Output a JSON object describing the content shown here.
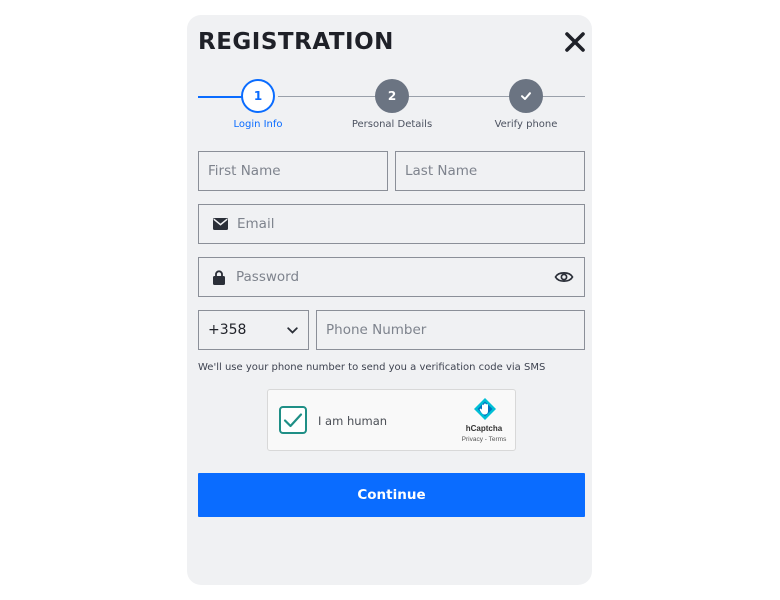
{
  "modal": {
    "title": "REGISTRATION",
    "close_icon": "close-icon"
  },
  "steps": [
    {
      "number": "1",
      "label": "Login Info",
      "state": "active"
    },
    {
      "number": "2",
      "label": "Personal Details",
      "state": "pending"
    },
    {
      "icon": "check-icon",
      "label": "Verify phone",
      "state": "pending"
    }
  ],
  "form": {
    "first_name": {
      "placeholder": "First Name",
      "value": ""
    },
    "last_name": {
      "placeholder": "Last Name",
      "value": ""
    },
    "email": {
      "placeholder": "Email",
      "value": "",
      "icon": "envelope-icon"
    },
    "password": {
      "placeholder": "Password",
      "value": "",
      "icon": "lock-icon",
      "toggle_icon": "eye-icon"
    },
    "country_code": {
      "selected": "+358",
      "icon": "chevron-down-icon"
    },
    "phone": {
      "placeholder": "Phone Number",
      "value": ""
    },
    "hint": "We'll use your phone number to send you a verification code via SMS"
  },
  "captcha": {
    "label": "I am human",
    "checked": true,
    "brand": "hCaptcha",
    "links": "Privacy - Terms"
  },
  "actions": {
    "continue_label": "Continue"
  },
  "colors": {
    "accent": "#0a6cff",
    "step_pending": "#6b7482",
    "modal_bg": "#f0f1f3",
    "captcha_check": "#1f8f86"
  }
}
